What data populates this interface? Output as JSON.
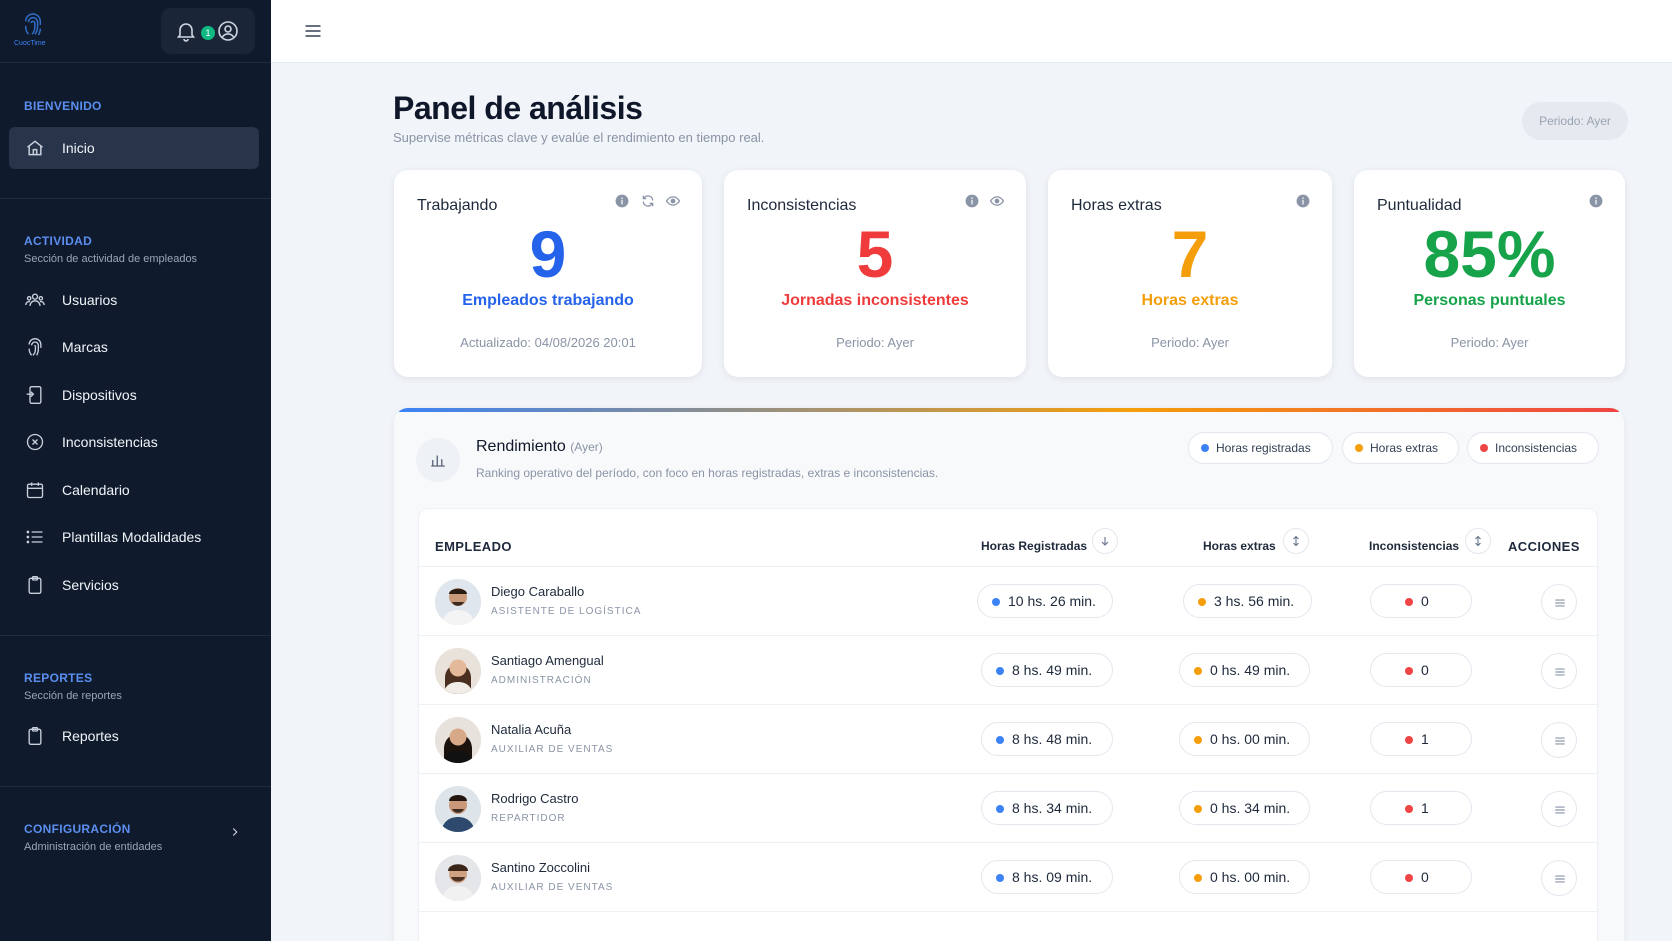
{
  "app": {
    "logo_text": "CuocTime"
  },
  "notifications": {
    "count": "1"
  },
  "sidebar": {
    "sections": [
      {
        "title": "BIENVENIDO",
        "subtitle": ""
      },
      {
        "title": "ACTIVIDAD",
        "subtitle": "Sección de actividad de empleados"
      },
      {
        "title": "REPORTES",
        "subtitle": "Sección de reportes"
      },
      {
        "title": "CONFIGURACIÓN",
        "subtitle": "Administración de entidades"
      }
    ],
    "items": [
      {
        "label": "Inicio",
        "icon": "home-icon",
        "active": true
      },
      {
        "label": "Usuarios",
        "icon": "users-icon"
      },
      {
        "label": "Marcas",
        "icon": "fingerprint-icon"
      },
      {
        "label": "Dispositivos",
        "icon": "device-icon"
      },
      {
        "label": "Inconsistencias",
        "icon": "x-circle-icon"
      },
      {
        "label": "Calendario",
        "icon": "calendar-icon"
      },
      {
        "label": "Plantillas Modalidades",
        "icon": "list-icon"
      },
      {
        "label": "Servicios",
        "icon": "clipboard-icon"
      },
      {
        "label": "Reportes",
        "icon": "clipboard-icon"
      }
    ]
  },
  "page": {
    "title": "Panel de análisis",
    "subtitle": "Supervise métricas clave y evalúe el rendimiento en tiempo real.",
    "period": "Periodo: Ayer"
  },
  "cards": [
    {
      "title": "Trabajando",
      "value": "9",
      "label": "Empleados trabajando",
      "footer": "Actualizado: 04/08/2026 20:01",
      "color": "#2563eb"
    },
    {
      "title": "Inconsistencias",
      "value": "5",
      "label": "Jornadas inconsistentes",
      "footer": "Periodo: Ayer",
      "color": "#ef3b3b"
    },
    {
      "title": "Horas extras",
      "value": "7",
      "label": "Horas extras",
      "footer": "Periodo: Ayer",
      "color": "#f59e0b"
    },
    {
      "title": "Puntualidad",
      "value": "85%",
      "label": "Personas puntuales",
      "footer": "Periodo: Ayer",
      "color": "#16a34a"
    }
  ],
  "performance": {
    "title": "Rendimiento",
    "period_note": "(Ayer)",
    "subtitle": "Ranking operativo del período, con foco en horas registradas, extras e inconsistencias.",
    "legend": [
      {
        "label": "Horas registradas",
        "color": "#3b82f6"
      },
      {
        "label": "Horas extras",
        "color": "#f59e0b"
      },
      {
        "label": "Inconsistencias",
        "color": "#ef4444"
      }
    ],
    "columns": {
      "employee": "EMPLEADO",
      "registered": "Horas Registradas",
      "extra": "Horas extras",
      "inconsistencies": "Inconsistencias",
      "actions": "ACCIONES"
    },
    "rows": [
      {
        "name": "Diego Caraballo",
        "role": "ASISTENTE DE LOGÍSTICA",
        "registered": "10 hs. 26 min.",
        "extra": "3 hs. 56 min.",
        "inconsistencies": "0"
      },
      {
        "name": "Santiago Amengual",
        "role": "ADMINISTRACIÓN",
        "registered": "8 hs. 49 min.",
        "extra": "0 hs. 49 min.",
        "inconsistencies": "0"
      },
      {
        "name": "Natalia Acuña",
        "role": "AUXILIAR DE VENTAS",
        "registered": "8 hs. 48 min.",
        "extra": "0 hs. 00 min.",
        "inconsistencies": "1"
      },
      {
        "name": "Rodrigo Castro",
        "role": "REPARTIDOR",
        "registered": "8 hs. 34 min.",
        "extra": "0 hs. 34 min.",
        "inconsistencies": "1"
      },
      {
        "name": "Santino Zoccolini",
        "role": "AUXILIAR DE VENTAS",
        "registered": "8 hs. 09 min.",
        "extra": "0 hs. 00 min.",
        "inconsistencies": "0"
      }
    ]
  }
}
